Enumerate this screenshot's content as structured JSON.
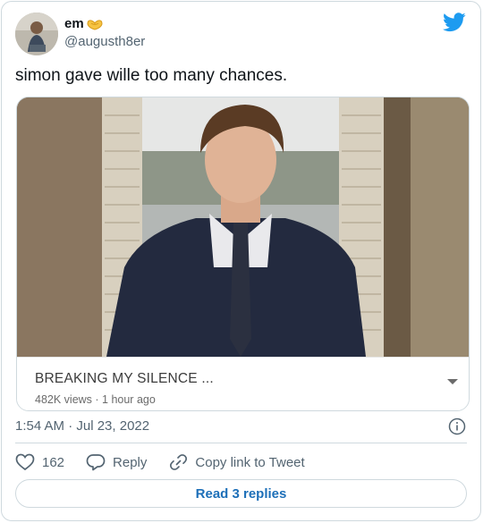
{
  "author": {
    "display_name": "em",
    "handle": "@augusth8er",
    "avatar_icon": "profile-photo",
    "emoji_icon": "yellow-heart-hands-emoji"
  },
  "tweet": {
    "text": "simon gave wille too many chances.",
    "timestamp": "1:54 AM · Jul 23, 2022"
  },
  "video_card": {
    "title": "BREAKING MY SILENCE ...",
    "meta": "482K views · 1 hour ago"
  },
  "actions": {
    "like_count": "162",
    "reply_label": "Reply",
    "copy_label": "Copy link to Tweet"
  },
  "read_replies_label": "Read 3 replies",
  "colors": {
    "twitter_blue": "#1d9bf0",
    "link_blue": "#1d6fb8",
    "secondary_text": "#536471",
    "border": "#cfd9de"
  }
}
